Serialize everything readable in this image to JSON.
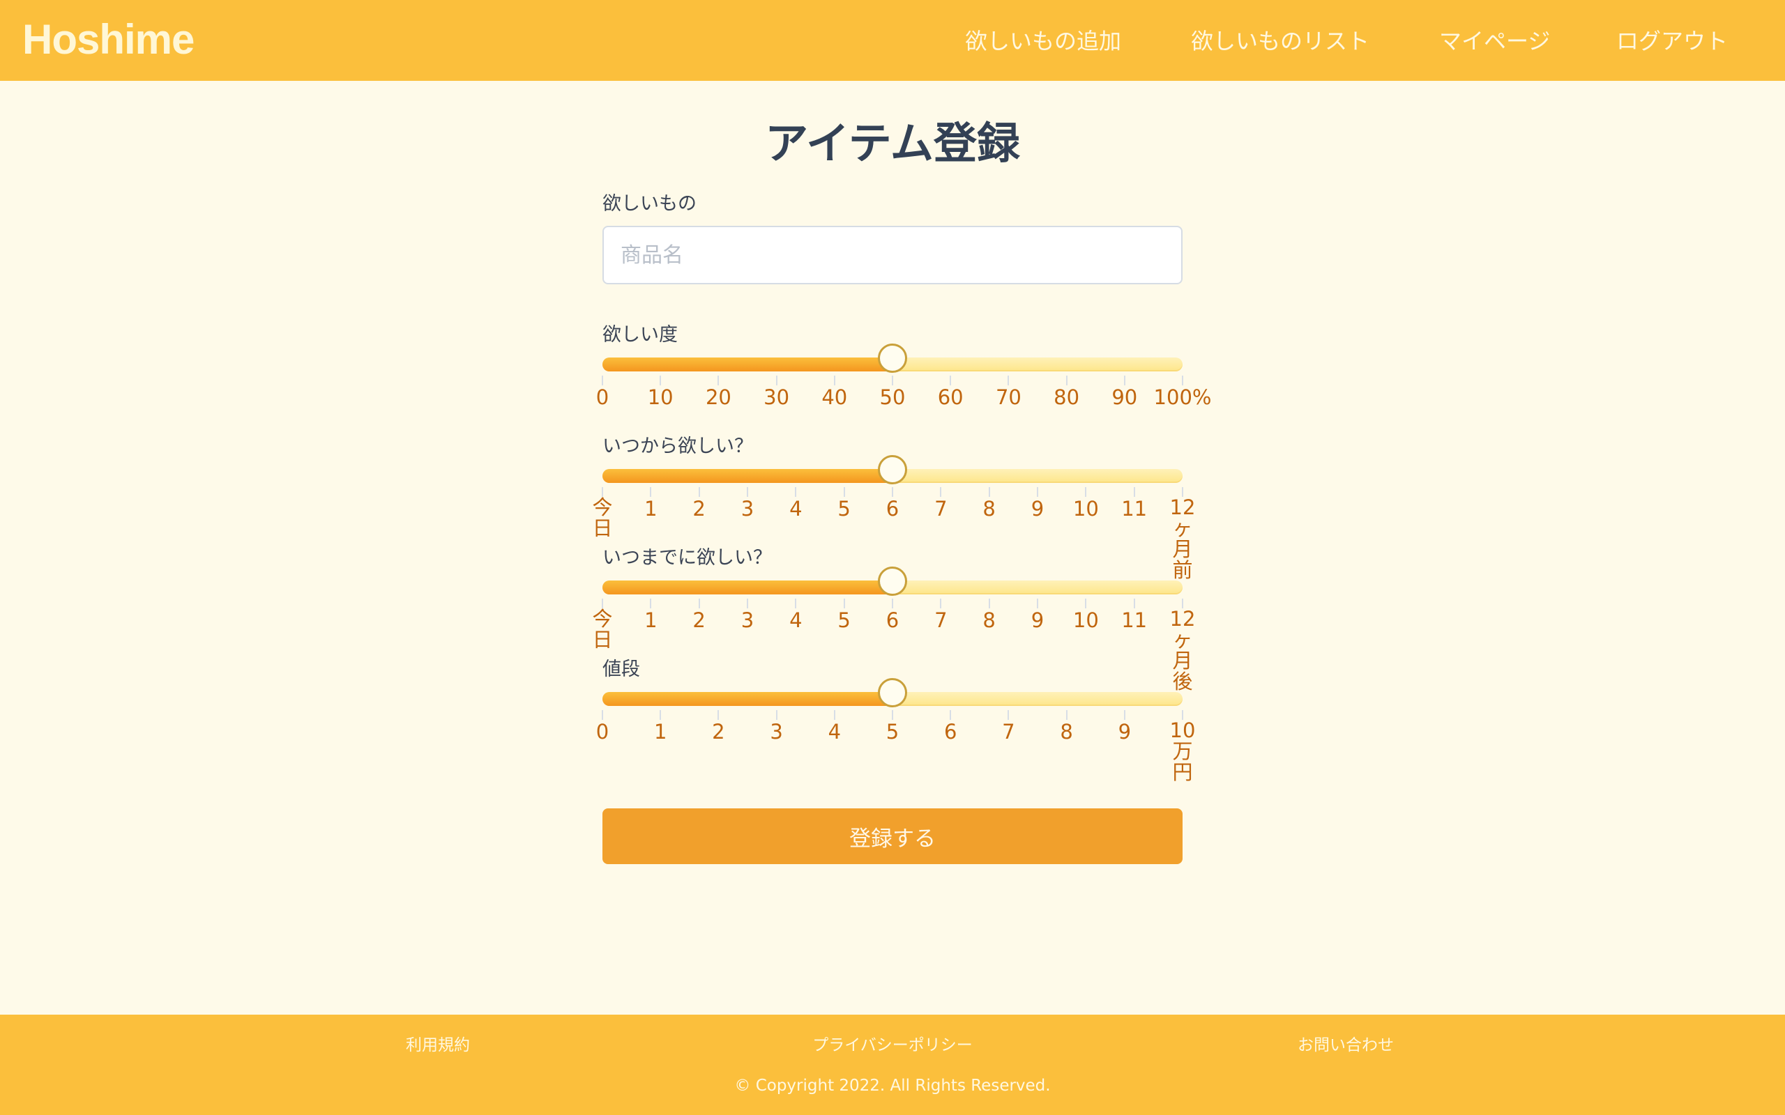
{
  "header": {
    "logo": "Hoshime",
    "nav": [
      "欲しいもの追加",
      "欲しいものリスト",
      "マイページ",
      "ログアウト"
    ]
  },
  "page_title": "アイテム登録",
  "form": {
    "item_label": "欲しいもの",
    "item_value": "",
    "item_placeholder": "商品名",
    "sliders": [
      {
        "label": "欲しい度",
        "value": 50,
        "max": 100,
        "ticks": [
          "0",
          "10",
          "20",
          "30",
          "40",
          "50",
          "60",
          "70",
          "80",
          "90",
          "100%"
        ]
      },
      {
        "label": "いつから欲しい？",
        "value": 6,
        "max": 12,
        "ticks": [
          "今日",
          "1",
          "2",
          "3",
          "4",
          "5",
          "6",
          "7",
          "8",
          "9",
          "10",
          "11",
          "12ヶ月前"
        ],
        "vertical_labels": {
          "first": "今日",
          "last_tail": "ヶ月前",
          "last_head": "12"
        }
      },
      {
        "label": "いつまでに欲しい？",
        "value": 6,
        "max": 12,
        "ticks": [
          "今日",
          "1",
          "2",
          "3",
          "4",
          "5",
          "6",
          "7",
          "8",
          "9",
          "10",
          "11",
          "12ヶ月後"
        ],
        "vertical_labels": {
          "first": "今日",
          "last_tail": "ヶ月後",
          "last_head": "12"
        }
      },
      {
        "label": "値段",
        "value": 5,
        "max": 10,
        "ticks": [
          "0",
          "1",
          "2",
          "3",
          "4",
          "5",
          "6",
          "7",
          "8",
          "9",
          "10万円"
        ],
        "vertical_labels": {
          "last_tail": "万円",
          "last_head": "10"
        }
      }
    ],
    "submit_label": "登録する"
  },
  "footer": {
    "links": [
      "利用規約",
      "プライバシーポリシー",
      "お問い合わせ"
    ],
    "copyright": "© Copyright 2022. All Rights Reserved."
  },
  "colors": {
    "header_bg": "#fbbf3c",
    "page_bg": "#fefae9",
    "accent": "#f1a02c",
    "tick_label": "#c0650e"
  }
}
